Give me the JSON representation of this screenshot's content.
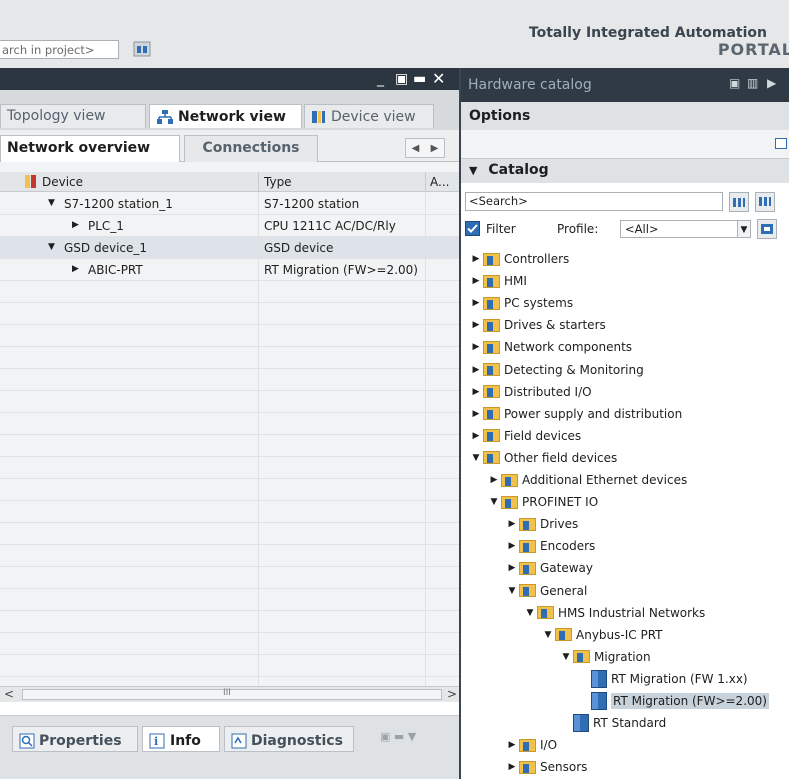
{
  "topbar": {
    "search_text": "arch in project>",
    "title": "Totally Integrated Automation",
    "subtitle": "PORTAL"
  },
  "left_panel": {
    "window_controls": [
      "_",
      "▣",
      "▬",
      "✕"
    ],
    "view_tabs": [
      {
        "label": "Topology view",
        "active": false
      },
      {
        "label": "Network view",
        "active": true
      },
      {
        "label": "Device view",
        "active": false
      }
    ],
    "overview_tabs": [
      {
        "label": "Network overview",
        "active": true
      },
      {
        "label": "Connections",
        "active": false
      }
    ],
    "table": {
      "headers": {
        "device": "Device",
        "type": "Type",
        "address": "A..."
      },
      "rows": [
        {
          "device": "S7-1200 station_1",
          "type": "S7-1200 station",
          "expanded": true,
          "level": 0
        },
        {
          "device": "PLC_1",
          "type": "CPU 1211C AC/DC/Rly",
          "expanded": false,
          "level": 1
        },
        {
          "device": "GSD device_1",
          "type": "GSD device",
          "expanded": true,
          "level": 0,
          "selected": true
        },
        {
          "device": "ABIC-PRT",
          "type": "RT Migration (FW>=2.00)",
          "expanded": false,
          "level": 1
        }
      ]
    },
    "hscroll_thumb": "III",
    "bottom_tabs": [
      {
        "label": "Properties",
        "active": false
      },
      {
        "label": "Info",
        "active": true
      },
      {
        "label": "Diagnostics",
        "active": false
      }
    ]
  },
  "catalog": {
    "title": "Hardware catalog",
    "options_label": "Options",
    "catalog_label": "Catalog",
    "search_value": "<Search>",
    "filter_label": "Filter",
    "filter_checked": true,
    "profile_label": "Profile:",
    "profile_value": "<All>",
    "tree": [
      {
        "label": "Controllers",
        "level": 0,
        "expanded": false,
        "kind": "folder"
      },
      {
        "label": "HMI",
        "level": 0,
        "expanded": false,
        "kind": "folder"
      },
      {
        "label": "PC systems",
        "level": 0,
        "expanded": false,
        "kind": "folder"
      },
      {
        "label": "Drives & starters",
        "level": 0,
        "expanded": false,
        "kind": "folder"
      },
      {
        "label": "Network components",
        "level": 0,
        "expanded": false,
        "kind": "folder"
      },
      {
        "label": "Detecting & Monitoring",
        "level": 0,
        "expanded": false,
        "kind": "folder"
      },
      {
        "label": "Distributed I/O",
        "level": 0,
        "expanded": false,
        "kind": "folder"
      },
      {
        "label": "Power supply and distribution",
        "level": 0,
        "expanded": false,
        "kind": "folder"
      },
      {
        "label": "Field devices",
        "level": 0,
        "expanded": false,
        "kind": "folder"
      },
      {
        "label": "Other field devices",
        "level": 0,
        "expanded": true,
        "kind": "folder"
      },
      {
        "label": "Additional Ethernet devices",
        "level": 1,
        "expanded": false,
        "kind": "folder"
      },
      {
        "label": "PROFINET IO",
        "level": 1,
        "expanded": true,
        "kind": "folder"
      },
      {
        "label": "Drives",
        "level": 2,
        "expanded": false,
        "kind": "folder"
      },
      {
        "label": "Encoders",
        "level": 2,
        "expanded": false,
        "kind": "folder"
      },
      {
        "label": "Gateway",
        "level": 2,
        "expanded": false,
        "kind": "folder"
      },
      {
        "label": "General",
        "level": 2,
        "expanded": true,
        "kind": "folder"
      },
      {
        "label": "HMS Industrial Networks",
        "level": 3,
        "expanded": true,
        "kind": "folder"
      },
      {
        "label": "Anybus-IC PRT",
        "level": 4,
        "expanded": true,
        "kind": "folder"
      },
      {
        "label": "Migration",
        "level": 5,
        "expanded": true,
        "kind": "folder"
      },
      {
        "label": "RT Migration (FW 1.xx)",
        "level": 6,
        "kind": "device"
      },
      {
        "label": "RT Migration (FW>=2.00)",
        "level": 6,
        "kind": "device",
        "selected": true
      },
      {
        "label": "RT Standard",
        "level": 5,
        "kind": "device"
      },
      {
        "label": "I/O",
        "level": 2,
        "expanded": false,
        "kind": "folder"
      },
      {
        "label": "Sensors",
        "level": 2,
        "expanded": false,
        "kind": "folder"
      }
    ]
  },
  "colors": {
    "dark_header": "#2c3640",
    "catalog_title": "#9eb0be",
    "folder": "#f2c14c",
    "device_icon": "#2f6db5",
    "selection": "#c8d2da"
  }
}
